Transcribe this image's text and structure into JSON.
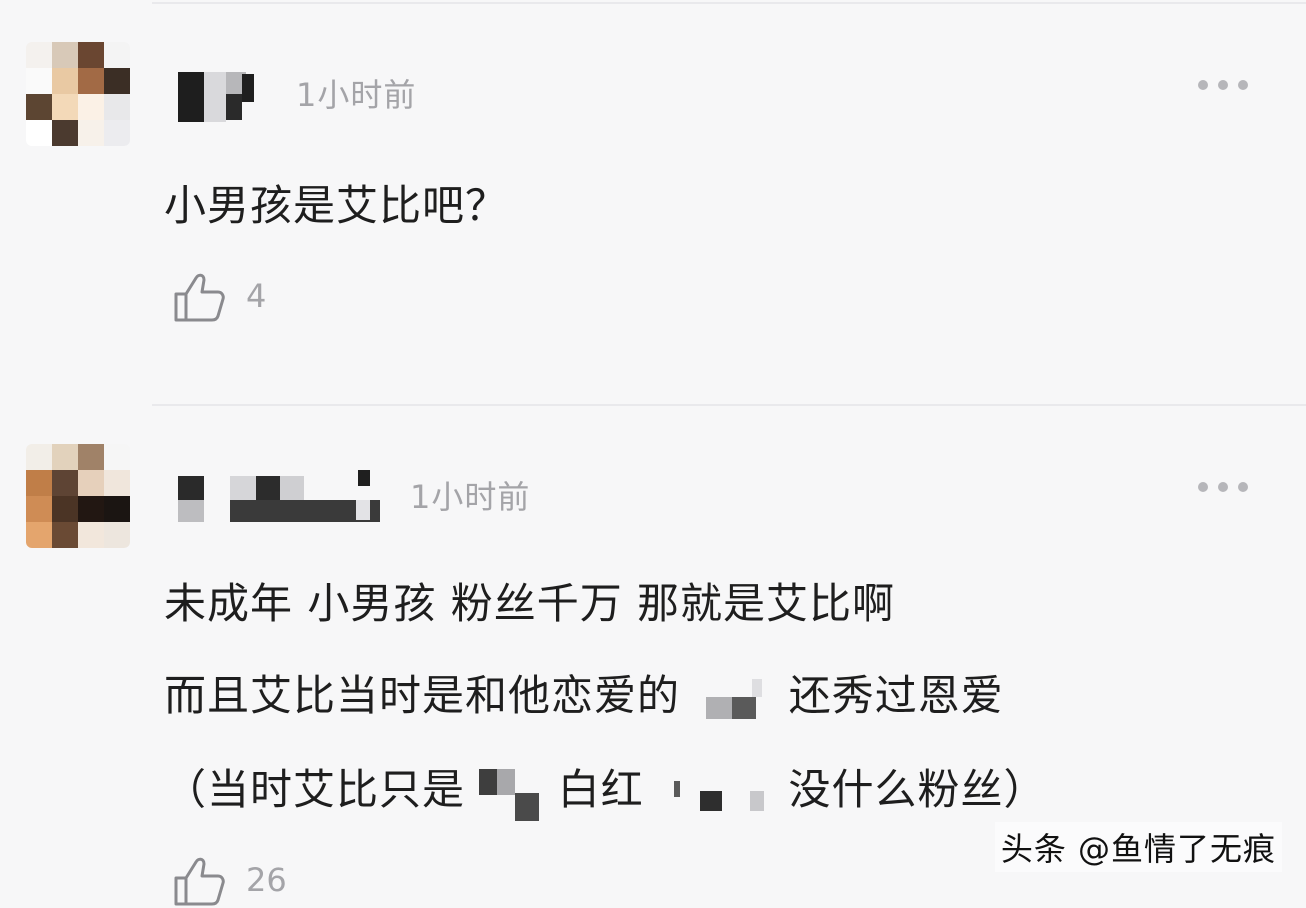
{
  "comments": [
    {
      "time": "1小时前",
      "text_lines": [
        "小男孩是艾比吧？"
      ],
      "likes": "4",
      "more_icon": "ellipsis-icon",
      "like_icon": "thumbs-up-icon"
    },
    {
      "time": "1小时前",
      "text_lines": [
        "未成年 小男孩 粉丝千万 那就是艾比啊",
        "而且艾比当时是和他恋爱的",
        "还秀过恩爱",
        "（当时艾比只是",
        "白红",
        "没什么粉丝）"
      ],
      "likes": "26",
      "more_icon": "ellipsis-icon",
      "like_icon": "thumbs-up-icon"
    }
  ],
  "watermark": "头条 @鱼情了无痕",
  "colors": {
    "background": "#f7f7f8",
    "meta_text": "#a4a4a8",
    "body_text": "#1e1e1e"
  }
}
